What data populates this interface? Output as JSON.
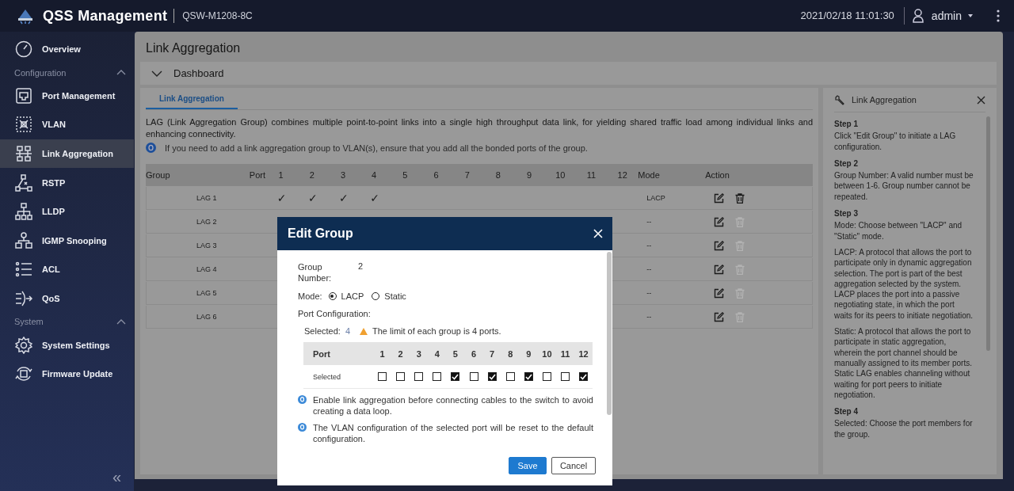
{
  "header": {
    "brand": "QSS Management",
    "model": "QSW-M1208-8C",
    "datetime": "2021/02/18 11:01:30",
    "user": "admin"
  },
  "sidebar": {
    "items": [
      {
        "kind": "item",
        "label": "Overview",
        "selected": false
      },
      {
        "kind": "section",
        "label": "Configuration",
        "expanded": true
      },
      {
        "kind": "item",
        "label": "Port Management",
        "selected": false
      },
      {
        "kind": "item",
        "label": "VLAN",
        "selected": false
      },
      {
        "kind": "item",
        "label": "Link Aggregation",
        "selected": true
      },
      {
        "kind": "item",
        "label": "RSTP",
        "selected": false
      },
      {
        "kind": "item",
        "label": "LLDP",
        "selected": false
      },
      {
        "kind": "item",
        "label": "IGMP Snooping",
        "selected": false
      },
      {
        "kind": "item",
        "label": "ACL",
        "selected": false
      },
      {
        "kind": "item",
        "label": "QoS",
        "selected": false
      },
      {
        "kind": "section",
        "label": "System",
        "expanded": true
      },
      {
        "kind": "item",
        "label": "System Settings",
        "selected": false
      },
      {
        "kind": "item",
        "label": "Firmware Update",
        "selected": false
      }
    ],
    "collapse": "«"
  },
  "page": {
    "title": "Link Aggregation",
    "dashboard": "Dashboard",
    "tabs": [
      {
        "label": "Link Aggregation",
        "selected": true
      }
    ],
    "description": "LAG (Link Aggregation Group) combines multiple point-to-point links into a single high throughput data link, for yielding shared traffic load among individual links and enhancing connectivity.",
    "note": "If you need to add a link aggregation group to VLAN(s), ensure that you add all the bonded ports of the group.",
    "table": {
      "columns": [
        "Group",
        "Port",
        "1",
        "2",
        "3",
        "4",
        "5",
        "6",
        "7",
        "8",
        "9",
        "10",
        "11",
        "12",
        "Mode",
        "Action"
      ],
      "rows": [
        {
          "group": "LAG 1",
          "port_cells": [
            "✓",
            "✓",
            "✓",
            "✓"
          ],
          "mode": "LACP",
          "delete_enabled": true
        },
        {
          "group": "LAG 2",
          "mode": "--",
          "delete_enabled": false
        },
        {
          "group": "LAG 3",
          "mode": "--",
          "delete_enabled": false
        },
        {
          "group": "LAG 4",
          "mode": "--",
          "delete_enabled": false
        },
        {
          "group": "LAG 5",
          "mode": "--",
          "delete_enabled": false
        },
        {
          "group": "LAG 6",
          "mode": "--",
          "delete_enabled": false
        }
      ]
    }
  },
  "help": {
    "title": "Link Aggregation",
    "blocks": [
      {
        "kind": "heading",
        "text": "Step 1"
      },
      {
        "kind": "paragraph",
        "text": "Click \"Edit Group\" to initiate a LAG configuration."
      },
      {
        "kind": "heading",
        "text": "Step 2"
      },
      {
        "kind": "paragraph",
        "text": "Group Number: A valid number must be between 1-6. Group number cannot be repeated."
      },
      {
        "kind": "heading",
        "text": "Step 3"
      },
      {
        "kind": "paragraph",
        "text": "Mode: Choose between \"LACP\" and \"Static\" mode."
      },
      {
        "kind": "paragraph",
        "text": "LACP: A protocol that allows the port to participate only in dynamic aggregation selection. The port is part of the best aggregation selected by the system. LACP places the port into a passive negotiating state, in which the port waits for its peers to initiate negotiation."
      },
      {
        "kind": "paragraph",
        "text": "Static: A protocol that allows the port to participate in static aggregation, wherein the port channel should be manually assigned to its member ports. Static LAG enables channeling without waiting for port peers to initiate negotiation."
      },
      {
        "kind": "heading",
        "text": "Step 4"
      },
      {
        "kind": "paragraph",
        "text": "Selected: Choose the port members for the group."
      }
    ]
  },
  "dialog": {
    "title": "Edit Group",
    "group_label": "Group Number:",
    "group_value": "2",
    "mode_label": "Mode:",
    "modes": [
      {
        "label": "LACP",
        "selected": true
      },
      {
        "label": "Static",
        "selected": false
      }
    ],
    "port_config_label": "Port Configuration:",
    "selected_label": "Selected:",
    "selected_count": "4",
    "warning": "The limit of each group is 4 ports.",
    "port_header": "Port",
    "selected_row": "Selected",
    "ports": [
      {
        "label": "1",
        "checked": false
      },
      {
        "label": "2",
        "checked": false
      },
      {
        "label": "3",
        "checked": false
      },
      {
        "label": "4",
        "checked": false
      },
      {
        "label": "5",
        "checked": true
      },
      {
        "label": "6",
        "checked": false
      },
      {
        "label": "7",
        "checked": true
      },
      {
        "label": "8",
        "checked": false
      },
      {
        "label": "9",
        "checked": true
      },
      {
        "label": "10",
        "checked": false
      },
      {
        "label": "11",
        "checked": false
      },
      {
        "label": "12",
        "checked": true
      }
    ],
    "notes": [
      "Enable link aggregation before connecting cables to the switch to avoid creating a data loop.",
      "The VLAN configuration of the selected port will be reset to the default configuration."
    ],
    "buttons": [
      {
        "kind": "primary",
        "label": "Save"
      },
      {
        "kind": "secondary",
        "label": "Cancel"
      }
    ]
  }
}
